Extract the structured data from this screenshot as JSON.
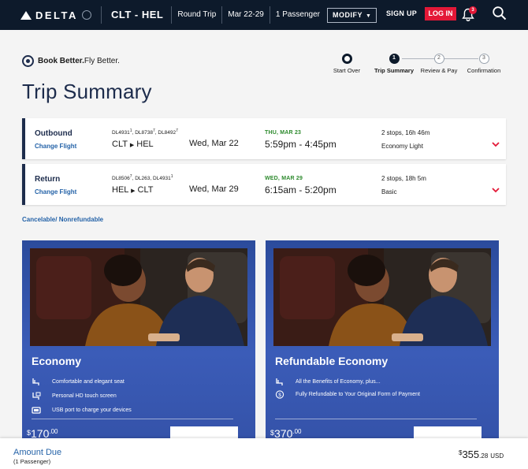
{
  "header": {
    "brand": "DELTA",
    "route": "CLT - HEL",
    "trip_type": "Round Trip",
    "dates": "Mar 22-29",
    "passengers": "1 Passenger",
    "modify_label": "MODIFY",
    "signup_label": "SIGN UP",
    "login_label": "LOG IN",
    "notification_count": "3"
  },
  "tagline": {
    "bold": "Book Better.",
    "rest": " Fly Better."
  },
  "page_title": "Trip Summary",
  "stepper": {
    "steps": [
      {
        "label": "Start Over",
        "num": ""
      },
      {
        "label": "Trip Summary",
        "num": "1"
      },
      {
        "label": "Review & Pay",
        "num": "2"
      },
      {
        "label": "Confirmation",
        "num": "3"
      }
    ]
  },
  "flights": [
    {
      "direction": "Outbound",
      "change_label": "Change Flight",
      "flight_numbers": [
        "DL4931",
        "DL8738",
        "DL8492"
      ],
      "flight_number_marks": [
        "1",
        "7",
        "7"
      ],
      "from": "CLT",
      "to": "HEL",
      "date": "Wed, Mar 22",
      "arrival_date": "THU, MAR 23",
      "times": "5:59pm - 4:45pm",
      "stops": "2 stops,  16h 46m",
      "cabin": "Economy Light"
    },
    {
      "direction": "Return",
      "change_label": "Change Flight",
      "flight_numbers": [
        "DL8506",
        "DL263",
        "DL4931"
      ],
      "flight_number_marks": [
        "7",
        "",
        "1"
      ],
      "from": "HEL",
      "to": "CLT",
      "date": "Wed, Mar 29",
      "arrival_date": "WED, MAR 29",
      "times": "6:15am - 5:20pm",
      "stops": "2 stops,  18h 5m",
      "cabin": "Basic"
    }
  ],
  "cancel_note": "Cancelable/ Nonrefundable",
  "fares": [
    {
      "name": "Economy",
      "features": [
        {
          "icon": "seat-icon",
          "text": "Comfortable and elegant seat"
        },
        {
          "icon": "seat-icon",
          "text": "Personal HD touch screen"
        },
        {
          "icon": "usb-icon",
          "text": "USB port to charge your devices"
        }
      ],
      "price_dollars": "170",
      "price_cents": ".00"
    },
    {
      "name": "Refundable Economy",
      "features": [
        {
          "icon": "seat-icon",
          "text": "All the Benefits of Economy, plus..."
        },
        {
          "icon": "dollar-icon",
          "text": "Fully Refundable to Your Original Form of Payment"
        }
      ],
      "price_dollars": "370",
      "price_cents": ".00"
    }
  ],
  "footer": {
    "amount_label": "Amount Due",
    "passengers": "(1 Passenger)",
    "total_dollars": "355",
    "total_cents": ".28",
    "currency": "USD"
  },
  "colors": {
    "header_bg": "#0d1a2b",
    "login_red": "#e31837",
    "link_blue": "#2563a8",
    "fare_blue": "#3452a8",
    "arrival_green": "#2d8a2d"
  }
}
